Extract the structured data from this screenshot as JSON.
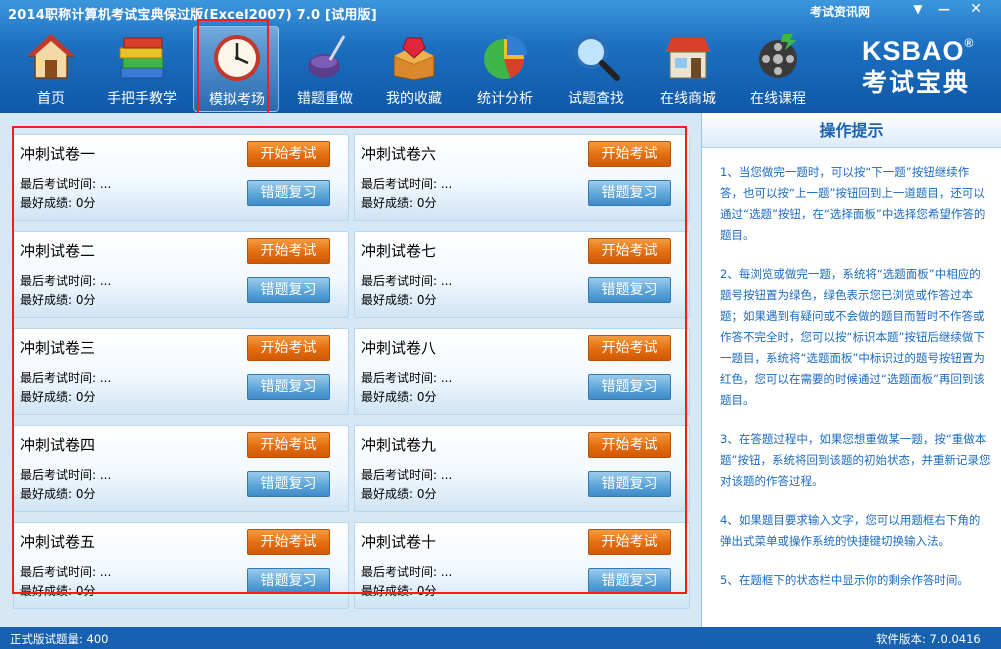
{
  "window": {
    "title": "2014职称计算机考试宝典保过版(Excel2007) 7.0 [试用版]",
    "news_link": "考试资讯网",
    "menu_glyph": "▼",
    "minimize_glyph": "—",
    "close_glyph": "✕"
  },
  "toolbar": {
    "items": [
      {
        "label": "首页",
        "icon": "house-icon"
      },
      {
        "label": "手把手教学",
        "icon": "books-icon"
      },
      {
        "label": "模拟考场",
        "icon": "clock-icon",
        "selected": true
      },
      {
        "label": "错题重做",
        "icon": "pen-ink-icon"
      },
      {
        "label": "我的收藏",
        "icon": "treasure-box-icon"
      },
      {
        "label": "统计分析",
        "icon": "pie-chart-icon"
      },
      {
        "label": "试题查找",
        "icon": "magnifier-icon"
      },
      {
        "label": "在线商城",
        "icon": "shop-icon"
      },
      {
        "label": "在线课程",
        "icon": "film-reel-icon"
      }
    ]
  },
  "logo": {
    "en": "KSBAO",
    "reg": "®",
    "cn": "考试宝典"
  },
  "papers": [
    {
      "name": "冲刺试卷一",
      "last_time": "最后考试时间: ...",
      "best_score": "最好成绩:   0分",
      "start": "开始考试",
      "review": "错题复习"
    },
    {
      "name": "冲刺试卷六",
      "last_time": "最后考试时间: ...",
      "best_score": "最好成绩:   0分",
      "start": "开始考试",
      "review": "错题复习"
    },
    {
      "name": "冲刺试卷二",
      "last_time": "最后考试时间: ...",
      "best_score": "最好成绩:   0分",
      "start": "开始考试",
      "review": "错题复习"
    },
    {
      "name": "冲刺试卷七",
      "last_time": "最后考试时间: ...",
      "best_score": "最好成绩:   0分",
      "start": "开始考试",
      "review": "错题复习"
    },
    {
      "name": "冲刺试卷三",
      "last_time": "最后考试时间: ...",
      "best_score": "最好成绩:   0分",
      "start": "开始考试",
      "review": "错题复习"
    },
    {
      "name": "冲刺试卷八",
      "last_time": "最后考试时间: ...",
      "best_score": "最好成绩:   0分",
      "start": "开始考试",
      "review": "错题复习"
    },
    {
      "name": "冲刺试卷四",
      "last_time": "最后考试时间: ...",
      "best_score": "最好成绩:   0分",
      "start": "开始考试",
      "review": "错题复习"
    },
    {
      "name": "冲刺试卷九",
      "last_time": "最后考试时间: ...",
      "best_score": "最好成绩:   0分",
      "start": "开始考试",
      "review": "错题复习"
    },
    {
      "name": "冲刺试卷五",
      "last_time": "最后考试时间: ...",
      "best_score": "最好成绩:   0分",
      "start": "开始考试",
      "review": "错题复习"
    },
    {
      "name": "冲刺试卷十",
      "last_time": "最后考试时间: ...",
      "best_score": "最好成绩:   0分",
      "start": "开始考试",
      "review": "错题复习"
    }
  ],
  "tips": {
    "title": "操作提示",
    "items": [
      "1、当您做完一题时，可以按“下一题”按钮继续作答，也可以按“上一题”按钮回到上一道题目，还可以通过“选题”按钮，在“选择面板”中选择您希望作答的题目。",
      "2、每浏览或做完一题，系统将“选题面板”中相应的题号按钮置为绿色，绿色表示您已浏览或作答过本题；如果遇到有疑问或不会做的题目而暂时不作答或作答不完全时，您可以按“标识本题”按钮后继续做下一题目，系统将“选题面板”中标识过的题号按钮置为红色，您可以在需要的时候通过“选题面板”再回到该题目。",
      "3、在答题过程中，如果您想重做某一题，按“重做本题”按钮，系统将回到该题的初始状态，并重新记录您对该题的作答过程。",
      "4、如果题目要求输入文字，您可以用题框右下角的弹出式菜单或操作系统的快捷键切换输入法。",
      "5、在题框下的状态栏中显示你的剩余作答时间。"
    ]
  },
  "status": {
    "left": "正式版试题量: 400",
    "right": "软件版本: 7.0.0416"
  }
}
